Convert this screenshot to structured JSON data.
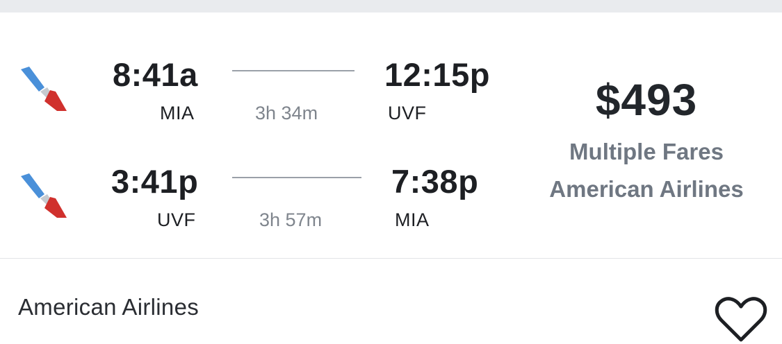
{
  "itinerary": {
    "outbound": {
      "depart_time": "8:41a",
      "depart_code": "MIA",
      "duration": "3h 34m",
      "arrive_time": "12:15p",
      "arrive_code": "UVF"
    },
    "return": {
      "depart_time": "3:41p",
      "depart_code": "UVF",
      "duration": "3h 57m",
      "arrive_time": "7:38p",
      "arrive_code": "MIA"
    },
    "logo_icon": "american-airlines-logo"
  },
  "price": {
    "amount": "$493",
    "fares_label": "Multiple Fares",
    "airline": "American Airlines"
  },
  "footer": {
    "airline": "American Airlines",
    "save_icon": "heart-outline-icon"
  },
  "colors": {
    "logo_blue": "#4a90d9",
    "logo_red": "#d0312d",
    "logo_gray": "#b8bcc2",
    "muted_text": "#6f7782"
  }
}
